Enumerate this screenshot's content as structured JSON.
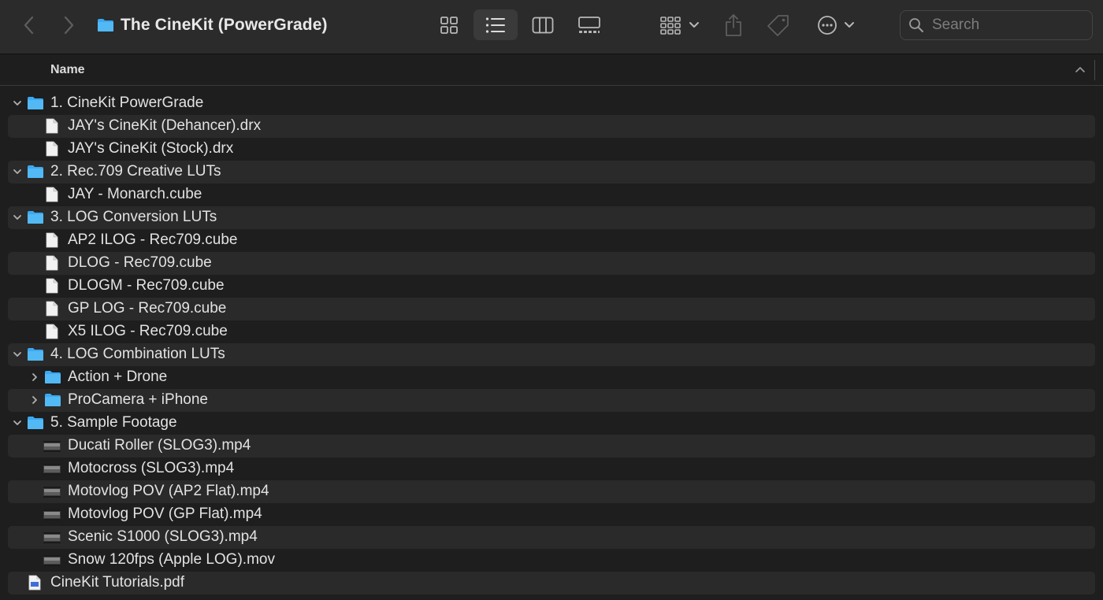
{
  "window": {
    "title": "The CineKit (PowerGrade)",
    "icons": {
      "back": "chevron-left-icon",
      "forward": "chevron-right-icon",
      "title_folder": "folder-icon"
    }
  },
  "toolbar": {
    "view_modes": [
      "icon-view",
      "list-view",
      "column-view",
      "gallery-view"
    ],
    "active_view": "list-view",
    "buttons": [
      "group-by",
      "share",
      "tags",
      "more-actions"
    ]
  },
  "search": {
    "placeholder": "Search"
  },
  "columns": {
    "name": "Name",
    "sort": "ascending"
  },
  "colors": {
    "folder": "#3ba8f0",
    "background": "#1e1e1e",
    "row_alt": "#2a2a2a",
    "toolbar": "#2b2b2b"
  },
  "rows": [
    {
      "label": "1. CineKit PowerGrade",
      "type": "folder",
      "depth": 0,
      "expanded": true
    },
    {
      "label": "JAY's CineKit (Dehancer).drx",
      "type": "file",
      "depth": 1
    },
    {
      "label": "JAY's CineKit (Stock).drx",
      "type": "file",
      "depth": 1
    },
    {
      "label": "2. Rec.709 Creative LUTs",
      "type": "folder",
      "depth": 0,
      "expanded": true
    },
    {
      "label": "JAY - Monarch.cube",
      "type": "file",
      "depth": 1
    },
    {
      "label": "3. LOG Conversion LUTs",
      "type": "folder",
      "depth": 0,
      "expanded": true
    },
    {
      "label": "AP2 ILOG - Rec709.cube",
      "type": "file",
      "depth": 1
    },
    {
      "label": "DLOG - Rec709.cube",
      "type": "file",
      "depth": 1
    },
    {
      "label": "DLOGM - Rec709.cube",
      "type": "file",
      "depth": 1
    },
    {
      "label": "GP LOG - Rec709.cube",
      "type": "file",
      "depth": 1
    },
    {
      "label": "X5 ILOG - Rec709.cube",
      "type": "file",
      "depth": 1
    },
    {
      "label": "4. LOG Combination LUTs",
      "type": "folder",
      "depth": 0,
      "expanded": true
    },
    {
      "label": "Action + Drone",
      "type": "folder",
      "depth": 1,
      "expanded": false
    },
    {
      "label": "ProCamera + iPhone",
      "type": "folder",
      "depth": 1,
      "expanded": false
    },
    {
      "label": "5. Sample Footage",
      "type": "folder",
      "depth": 0,
      "expanded": true
    },
    {
      "label": "Ducati Roller (SLOG3).mp4",
      "type": "video",
      "depth": 1
    },
    {
      "label": "Motocross (SLOG3).mp4",
      "type": "video",
      "depth": 1
    },
    {
      "label": "Motovlog POV (AP2 Flat).mp4",
      "type": "video",
      "depth": 1
    },
    {
      "label": "Motovlog POV (GP Flat).mp4",
      "type": "video",
      "depth": 1
    },
    {
      "label": "Scenic S1000 (SLOG3).mp4",
      "type": "video",
      "depth": 1
    },
    {
      "label": "Snow 120fps (Apple LOG).mov",
      "type": "video",
      "depth": 1
    },
    {
      "label": "CineKit Tutorials.pdf",
      "type": "pdf",
      "depth": 0
    }
  ]
}
